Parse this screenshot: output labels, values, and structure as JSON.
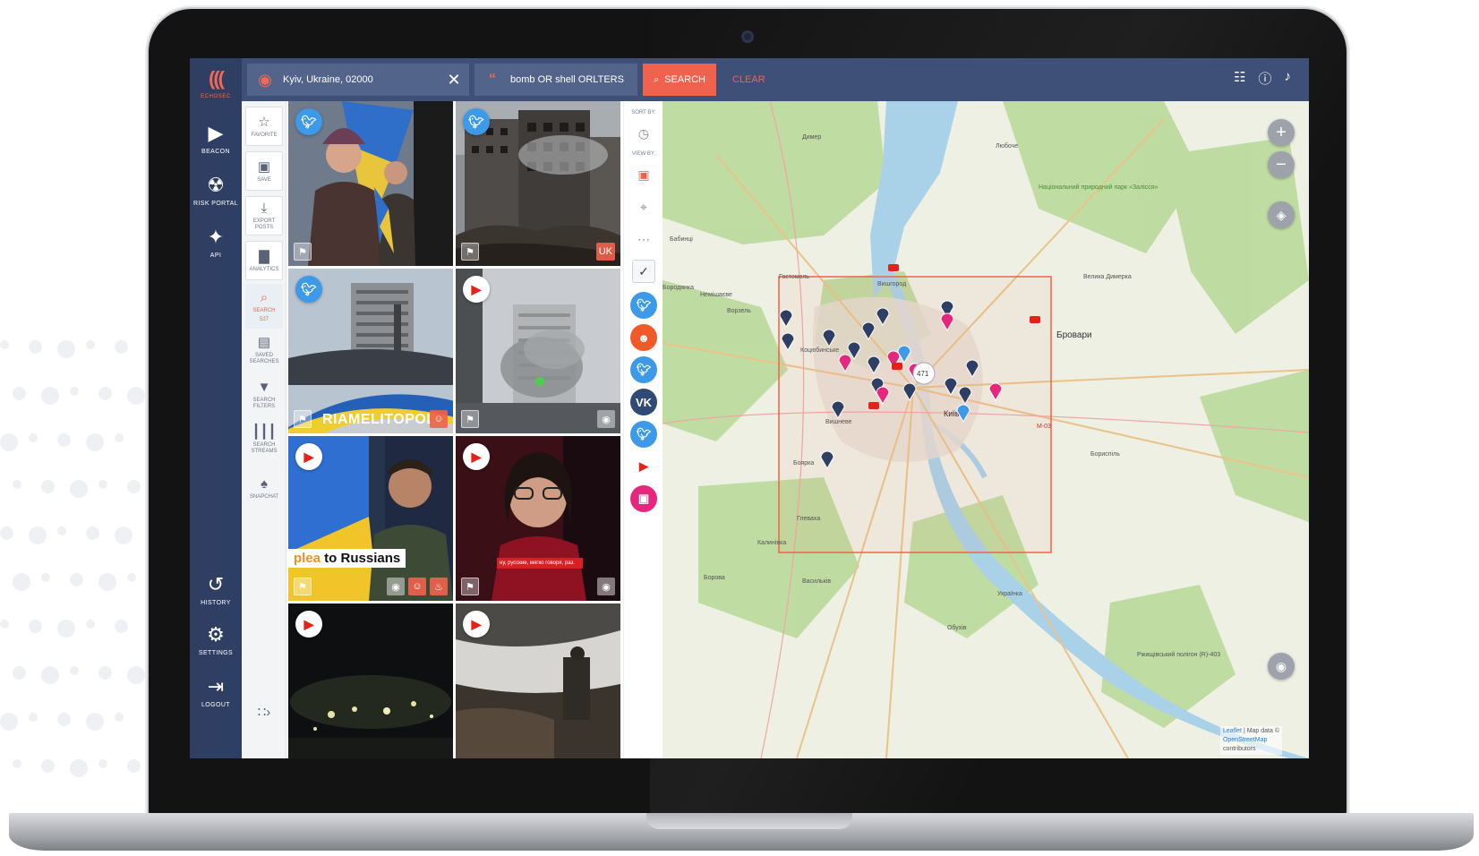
{
  "app": {
    "logo_label": "ECHOSEC",
    "nav": [
      {
        "label": "BEACON",
        "icon": "beacon-icon"
      },
      {
        "label": "RISK PORTAL",
        "icon": "fingerprint-icon"
      },
      {
        "label": "API",
        "icon": "api-icon"
      },
      {
        "label": "HISTORY",
        "icon": "history-icon"
      },
      {
        "label": "SETTINGS",
        "icon": "gear-icon"
      },
      {
        "label": "LOGOUT",
        "icon": "logout-icon"
      }
    ]
  },
  "topbar": {
    "location_value": "Kyiv, Ukraine, 02000",
    "query_value": "bomb OR shell ORLTERS",
    "search_label": "SEARCH",
    "clear_label": "CLEAR"
  },
  "tools": [
    {
      "label": "FAVORITE",
      "icon": "star-icon"
    },
    {
      "label": "SAVE",
      "icon": "floppy-icon"
    },
    {
      "label": "EXPORT POSTS",
      "icon": "download-icon"
    },
    {
      "label": "ANALYTICS",
      "icon": "bar-chart-icon"
    },
    {
      "label": "SEARCH",
      "count": "527",
      "icon": "search-icon"
    },
    {
      "label": "SAVED SEARCHES",
      "icon": "folder-icon"
    },
    {
      "label": "SEARCH FILTERS",
      "icon": "filter-icon"
    },
    {
      "label": "SEARCH STREAMS",
      "icon": "streams-icon"
    },
    {
      "label": "SNAPCHAT",
      "icon": "ghost-icon"
    }
  ],
  "posts": [
    {
      "source": "twitter"
    },
    {
      "source": "twitter",
      "tag": "UK"
    },
    {
      "source": "twitter",
      "caption": "RIAMELITOPOL"
    },
    {
      "source": "youtube"
    },
    {
      "source": "youtube",
      "caption_plain": " to Russians",
      "caption_highlight": "plea"
    },
    {
      "source": "youtube",
      "subtitle": "ну, русские, мягко говоря, раз."
    },
    {
      "source": "youtube"
    },
    {
      "source": "youtube"
    }
  ],
  "sorter": {
    "sort_label": "SORT BY:",
    "view_label": "VIEW BY:"
  },
  "map": {
    "place_labels": [
      "Димер",
      "Любоче",
      "Вишгород",
      "Бабинці",
      "Бородянка",
      "Немішаєве",
      "Ворзель",
      "Гостомель",
      "Коцюбинське",
      "Бровари",
      "Велика Димерка",
      "Вишневе",
      "Боярка",
      "Глеваха",
      "Калинівка",
      "Борова",
      "Васильків",
      "Українка",
      "Обухів",
      "Бориспіль",
      "Київ",
      "М-03",
      "Національний природний парк «Залісся»",
      "Ржищівський полігон (R)-403"
    ],
    "cluster_count": "471",
    "attribution_leaflet": "Leaflet",
    "attribution_text": "| Map data ©",
    "attribution_osm": "OpenStreetMap",
    "attribution_contrib": "contributors"
  }
}
